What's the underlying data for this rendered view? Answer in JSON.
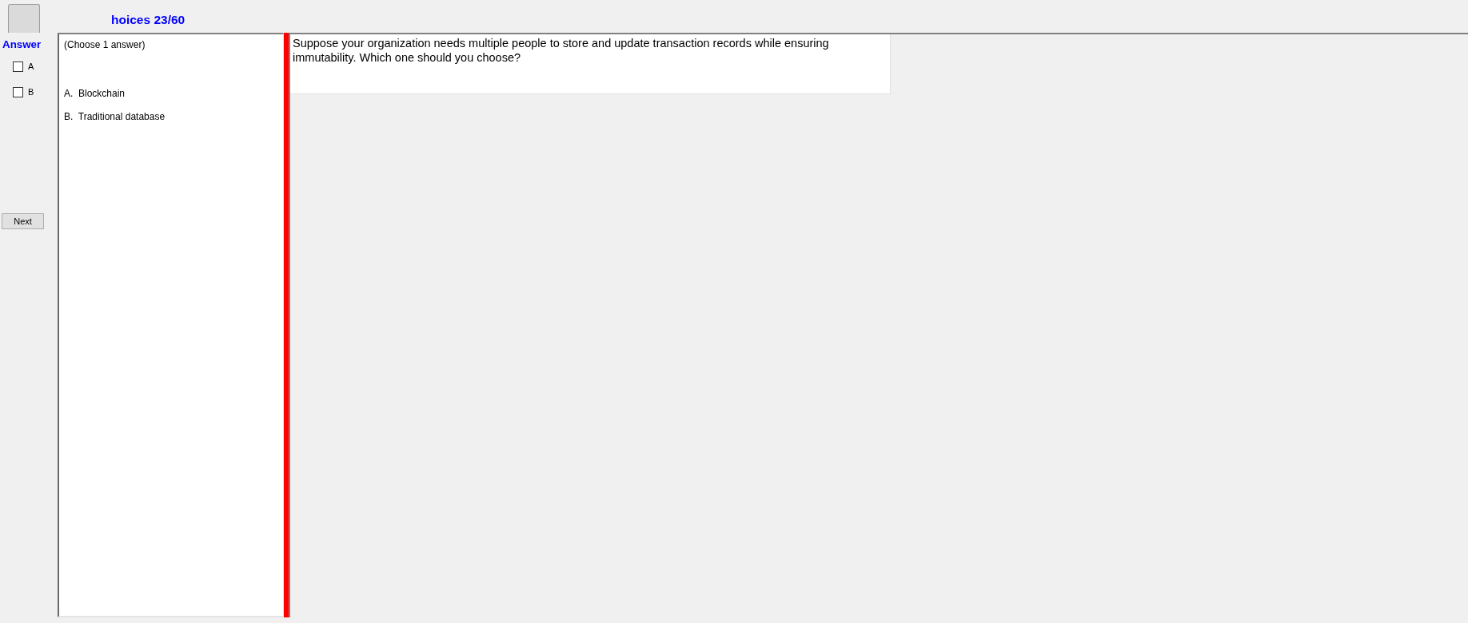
{
  "header": {
    "counter": "hoices 23/60"
  },
  "answer_panel": {
    "title": "Answer",
    "options": [
      {
        "label": "A",
        "checked": false
      },
      {
        "label": "B",
        "checked": false
      }
    ],
    "next_button": "Next"
  },
  "choices_panel": {
    "instruction": "(Choose 1 answer)",
    "choices": [
      "A.  Blockchain",
      "B.  Traditional database"
    ]
  },
  "question": {
    "text": "Suppose your organization needs multiple people to store and update transaction records while ensuring immutability. Which one should you choose?"
  }
}
